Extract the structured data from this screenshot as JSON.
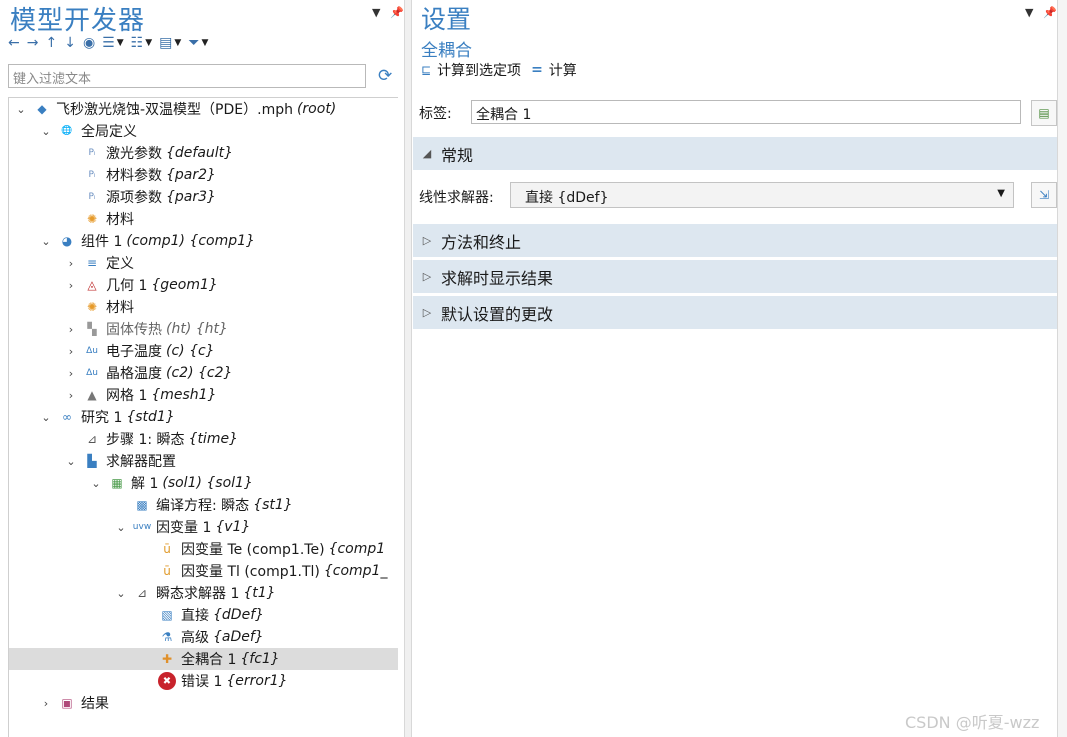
{
  "model_builder": {
    "title": "模型开发器",
    "filter_placeholder": "键入过滤文本",
    "tree": [
      {
        "label": "飞秒激光烧蚀-双温模型（PDE）.mph",
        "tag": "(root)",
        "icon": "model-icon"
      },
      {
        "label": "全局定义",
        "tag": "",
        "icon": "globe-icon"
      },
      {
        "label": "激光参数",
        "tag": "{default}",
        "icon": "parameters-icon"
      },
      {
        "label": "材料参数",
        "tag": "{par2}",
        "icon": "parameters-icon"
      },
      {
        "label": "源项参数",
        "tag": "{par3}",
        "icon": "parameters-icon"
      },
      {
        "label": "材料",
        "tag": "",
        "icon": "materials-icon"
      },
      {
        "label": "组件 1",
        "tag": "(comp1) {comp1}",
        "icon": "component-icon"
      },
      {
        "label": "定义",
        "tag": "",
        "icon": "definitions-icon"
      },
      {
        "label": "几何 1",
        "tag": "{geom1}",
        "icon": "geometry-icon"
      },
      {
        "label": "材料",
        "tag": "",
        "icon": "materials-icon"
      },
      {
        "label": "固体传热",
        "tag": "(ht) {ht}",
        "icon": "heat-transfer-icon"
      },
      {
        "label": "电子温度",
        "tag": "(c) {c}",
        "icon": "pde-icon"
      },
      {
        "label": "晶格温度",
        "tag": "(c2) {c2}",
        "icon": "pde-icon"
      },
      {
        "label": "网格 1",
        "tag": "{mesh1}",
        "icon": "mesh-icon"
      },
      {
        "label": "研究 1",
        "tag": "{std1}",
        "icon": "study-icon"
      },
      {
        "label": "步骤 1: 瞬态",
        "tag": "{time}",
        "icon": "time-step-icon"
      },
      {
        "label": "求解器配置",
        "tag": "",
        "icon": "solver-config-icon"
      },
      {
        "label": "解 1",
        "tag": "(sol1) {sol1}",
        "icon": "solution-icon"
      },
      {
        "label": "编译方程: 瞬态",
        "tag": "{st1}",
        "icon": "compile-icon"
      },
      {
        "label": "因变量 1",
        "tag": "{v1}",
        "icon": "dependent-variables-icon"
      },
      {
        "label": "因变量 Te (comp1.Te)",
        "tag": "{comp1",
        "icon": "field-icon"
      },
      {
        "label": "因变量 Tl (comp1.Tl)",
        "tag": "{comp1_",
        "icon": "field-icon"
      },
      {
        "label": "瞬态求解器 1",
        "tag": "{t1}",
        "icon": "time-solver-icon"
      },
      {
        "label": "直接",
        "tag": "{dDef}",
        "icon": "direct-solver-icon"
      },
      {
        "label": "高级",
        "tag": "{aDef}",
        "icon": "advanced-icon"
      },
      {
        "label": "全耦合 1",
        "tag": "{fc1}",
        "icon": "fully-coupled-icon"
      },
      {
        "label": "错误 1",
        "tag": "{error1}",
        "icon": "error-icon"
      },
      {
        "label": "结果",
        "tag": "",
        "icon": "results-icon"
      }
    ]
  },
  "settings": {
    "title": "设置",
    "subtitle": "全耦合",
    "compute_selected": "计算到选定项",
    "compute": "计算",
    "label_caption": "标签:",
    "label_value": "全耦合 1",
    "section_general": "常规",
    "linear_solver_caption": "线性求解器:",
    "linear_solver_value": "直接 {dDef}",
    "section_method": "方法和终止",
    "section_results": "求解时显示结果",
    "section_defaults": "默认设置的更改"
  },
  "watermark": "CSDN @听夏-wzz"
}
